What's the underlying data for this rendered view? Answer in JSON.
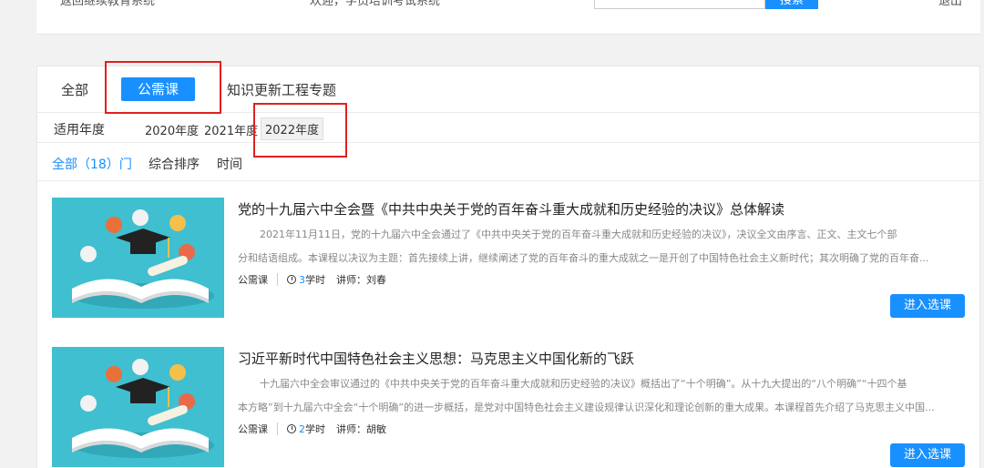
{
  "header": {
    "back_text": "返回继续教育系统",
    "mid_text": "欢迎，学员培训考试系统",
    "search_button": "搜索",
    "exit_text": "退出"
  },
  "tabs": [
    {
      "label": "全部"
    },
    {
      "label": "公需课",
      "active": true
    },
    {
      "label": "知识更新工程专题"
    }
  ],
  "year_filter": {
    "label": "适用年度",
    "options": [
      "2020年度",
      "2021年度",
      "2022年度"
    ],
    "selected": "2022年度"
  },
  "sort": {
    "all_label": "全部（18）门",
    "composite": "综合排序",
    "time": "时间"
  },
  "courses": [
    {
      "title": "党的十九届六中全会暨《中共中央关于党的百年奋斗重大成就和历史经验的决议》总体解读",
      "desc_line1": "2021年11月11日，党的十九届六中全会通过了《中共中央关于党的百年奋斗重大成就和历史经验的决议》，决议全文由序言、正文、主文七个部",
      "desc_line2": "分和结语组成。本课程以决议为主题：首先接续上讲，继续阐述了党的百年奋斗的重大成就之一是开创了中国特色社会主义新时代；其次明确了党的百年奋...",
      "type": "公需课",
      "hours_num": "3",
      "hours_unit": "学时",
      "teacher": "讲师：刘春",
      "button": "进入选课"
    },
    {
      "title": "习近平新时代中国特色社会主义思想：马克思主义中国化新的飞跃",
      "desc_line1": "十九届六中全会审议通过的《中共中央关于党的百年奋斗重大成就和历史经验的决议》概括出了“十个明确”。从十九大提出的“八个明确”“十四个基",
      "desc_line2": "本方略”到十九届六中全会“十个明确”的进一步概括，是党对中国特色社会主义建设规律认识深化和理论创新的重大成果。本课程首先介绍了马克思主义中国...",
      "type": "公需课",
      "hours_num": "2",
      "hours_unit": "学时",
      "teacher": "讲师：胡敏",
      "button": "进入选课"
    }
  ],
  "colors": {
    "accent": "#1890ff",
    "highlight_box": "#e02020",
    "thumb_bg": "#3fbfcf"
  }
}
